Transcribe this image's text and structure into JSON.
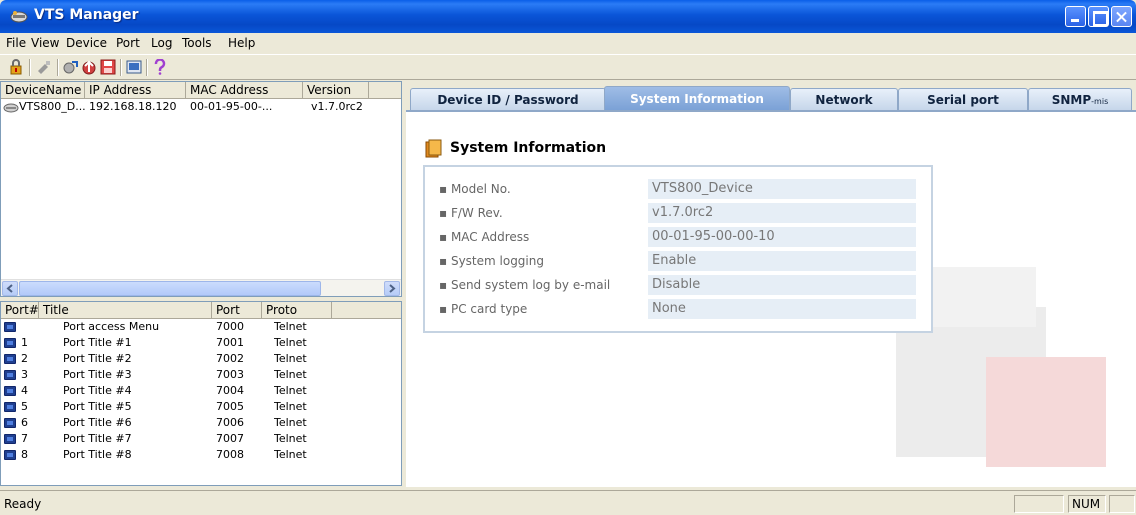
{
  "window": {
    "title": "VTS Manager"
  },
  "menu": [
    "File",
    "View",
    "Device",
    "Port",
    "Log",
    "Tools",
    "Help"
  ],
  "toolbar": {
    "icons": [
      "lock-icon",
      "disconnect-icon",
      "connect-icon",
      "upload-icon",
      "save-icon",
      "console-icon",
      "help-icon"
    ]
  },
  "devices": {
    "columns": [
      "DeviceName",
      "IP Address",
      "MAC Address",
      "Version"
    ],
    "rows": [
      {
        "name": "VTS800_D...",
        "ip": "192.168.18.120",
        "mac": "00-01-95-00-...",
        "version": "v1.7.0rc2"
      }
    ]
  },
  "ports": {
    "columns": [
      "Port#",
      "Title",
      "Port",
      "Proto"
    ],
    "rows": [
      {
        "num": "",
        "title": "Port access Menu",
        "port": "7000",
        "proto": "Telnet"
      },
      {
        "num": "1",
        "title": "Port Title #1",
        "port": "7001",
        "proto": "Telnet"
      },
      {
        "num": "2",
        "title": "Port Title #2",
        "port": "7002",
        "proto": "Telnet"
      },
      {
        "num": "3",
        "title": "Port Title #3",
        "port": "7003",
        "proto": "Telnet"
      },
      {
        "num": "4",
        "title": "Port Title #4",
        "port": "7004",
        "proto": "Telnet"
      },
      {
        "num": "5",
        "title": "Port Title #5",
        "port": "7005",
        "proto": "Telnet"
      },
      {
        "num": "6",
        "title": "Port Title #6",
        "port": "7006",
        "proto": "Telnet"
      },
      {
        "num": "7",
        "title": "Port Title #7",
        "port": "7007",
        "proto": "Telnet"
      },
      {
        "num": "8",
        "title": "Port Title #8",
        "port": "7008",
        "proto": "Telnet"
      }
    ]
  },
  "tabs": [
    {
      "label": "Device ID / Password",
      "suffix": ""
    },
    {
      "label": "System Information",
      "suffix": ""
    },
    {
      "label": "Network",
      "suffix": ""
    },
    {
      "label": "Serial port",
      "suffix": ""
    },
    {
      "label": "SNMP",
      "suffix": "-mis"
    }
  ],
  "active_tab": "System Information",
  "system_info": {
    "heading": "System Information",
    "fields": [
      {
        "label": "Model No.",
        "value": "VTS800_Device"
      },
      {
        "label": "F/W Rev.",
        "value": "v1.7.0rc2"
      },
      {
        "label": "MAC Address",
        "value": "00-01-95-00-00-10"
      },
      {
        "label": "System logging",
        "value": "Enable"
      },
      {
        "label": "Send system log by e-mail",
        "value": "Disable"
      },
      {
        "label": "PC card type",
        "value": "None"
      }
    ]
  },
  "status": {
    "text": "Ready",
    "num_indicator": "NUM"
  },
  "colors": {
    "titlebar": "#0a55d8",
    "tab_active": "#7ba1d6",
    "field_bg": "#e6eef6"
  }
}
